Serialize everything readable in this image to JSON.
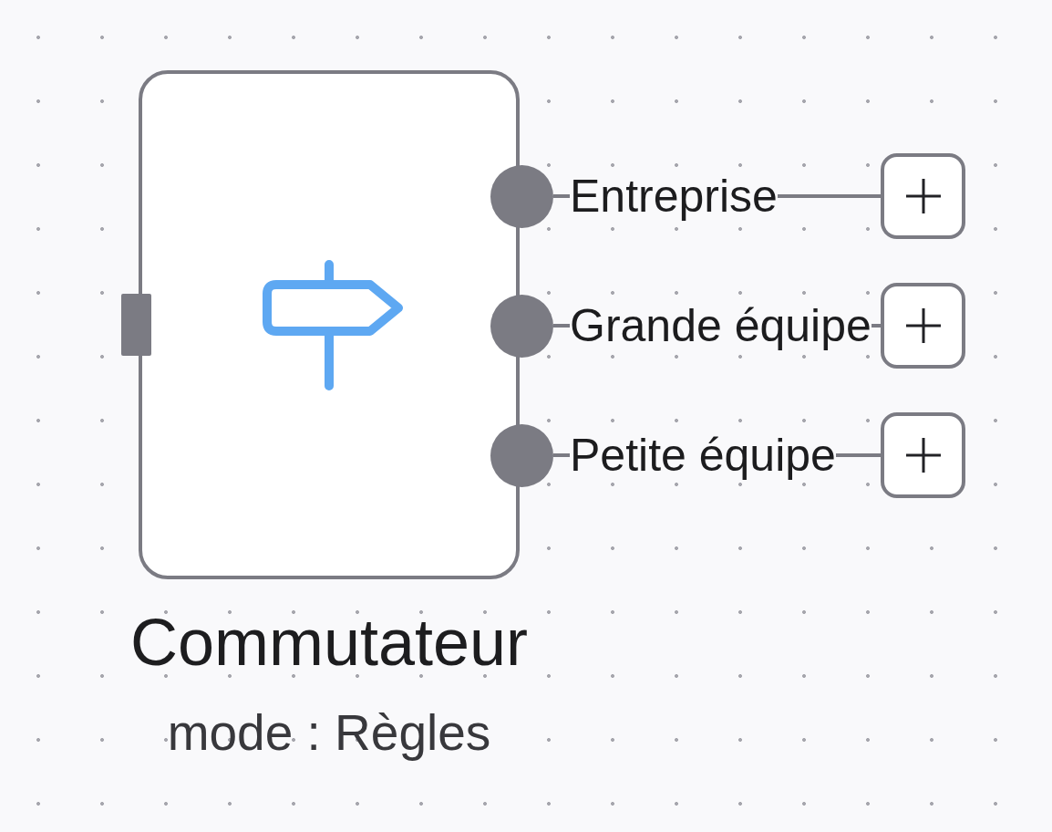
{
  "node": {
    "outputs": [
      {
        "label": "Entreprise"
      },
      {
        "label": "Grande équipe"
      },
      {
        "label": "Petite équipe"
      }
    ],
    "title": "Commutateur",
    "subtitle": "mode : Règles"
  }
}
